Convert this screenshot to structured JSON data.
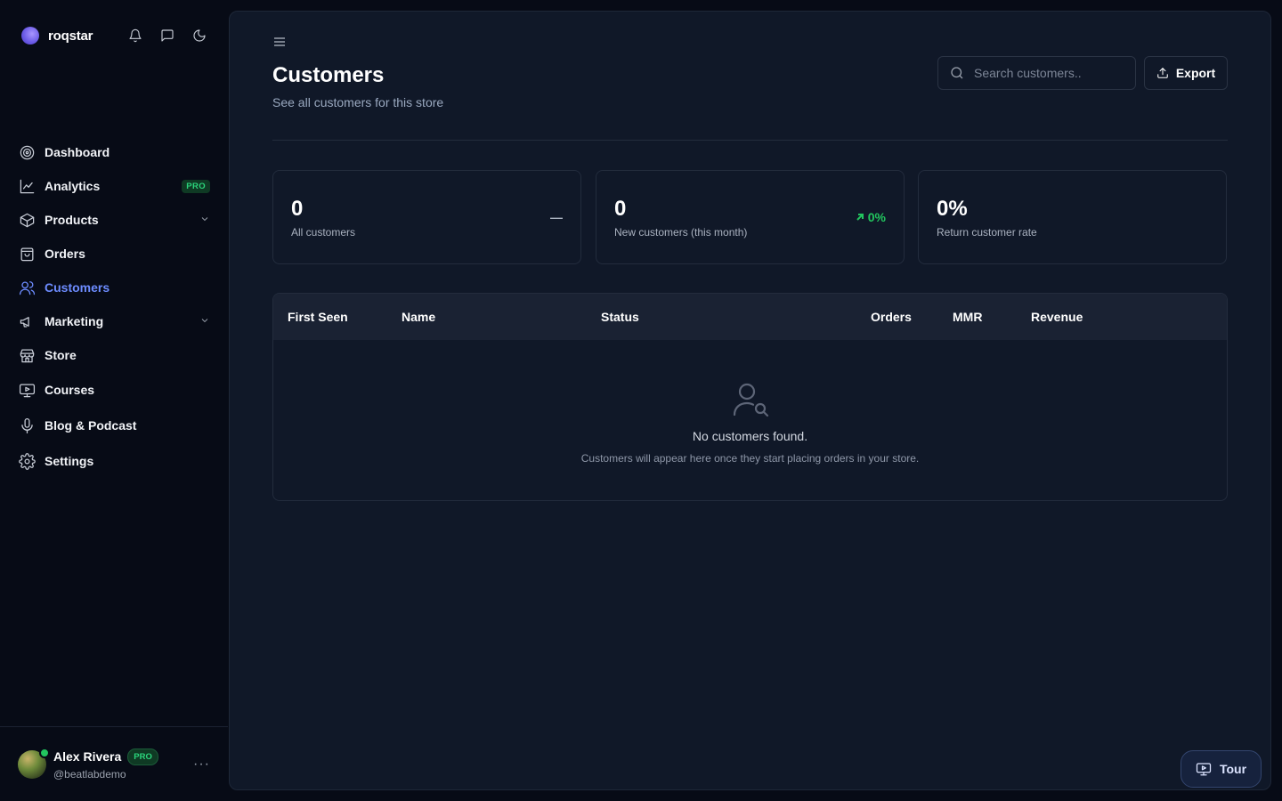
{
  "brand": {
    "name": "roqstar"
  },
  "header_icons": [
    "bell-icon",
    "message-icon",
    "moon-icon"
  ],
  "sidebar": {
    "items": [
      {
        "label": "Dashboard",
        "icon": "dashboard-icon"
      },
      {
        "label": "Analytics",
        "icon": "analytics-icon",
        "badge": "PRO"
      },
      {
        "label": "Products",
        "icon": "box-icon"
      },
      {
        "label": "Orders",
        "icon": "bag-icon"
      },
      {
        "label": "Customers",
        "icon": "users-icon",
        "active": true
      },
      {
        "label": "Marketing",
        "icon": "megaphone-icon"
      },
      {
        "label": "Store",
        "icon": "store-icon"
      },
      {
        "label": "Courses",
        "icon": "presentation-icon"
      },
      {
        "label": "Blog & Podcast",
        "icon": "microphone-icon"
      },
      {
        "label": "Settings",
        "icon": "gear-icon"
      }
    ]
  },
  "user": {
    "name": "Alex Rivera",
    "badge": "PRO",
    "handle": "@beatlabdemo"
  },
  "page": {
    "title": "Customers",
    "subtitle": "See all customers for this store",
    "search_placeholder": "Search customers..",
    "export_label": "Export"
  },
  "stats": [
    {
      "value": "0",
      "label": "All customers",
      "trend": "—"
    },
    {
      "value": "0",
      "label": "New customers (this month)",
      "trend": "0%"
    },
    {
      "value": "0%",
      "label": "Return customer rate"
    }
  ],
  "table": {
    "columns": [
      "First Seen",
      "Name",
      "Status",
      "Orders",
      "MMR",
      "Revenue"
    ],
    "empty_title": "No customers found.",
    "empty_desc": "Customers will appear here once they start placing orders in your store."
  },
  "tour_label": "Tour",
  "colors": {
    "accent": "#6d8cff",
    "success": "#22c55e",
    "panel": "#101828",
    "background": "#070b16"
  }
}
